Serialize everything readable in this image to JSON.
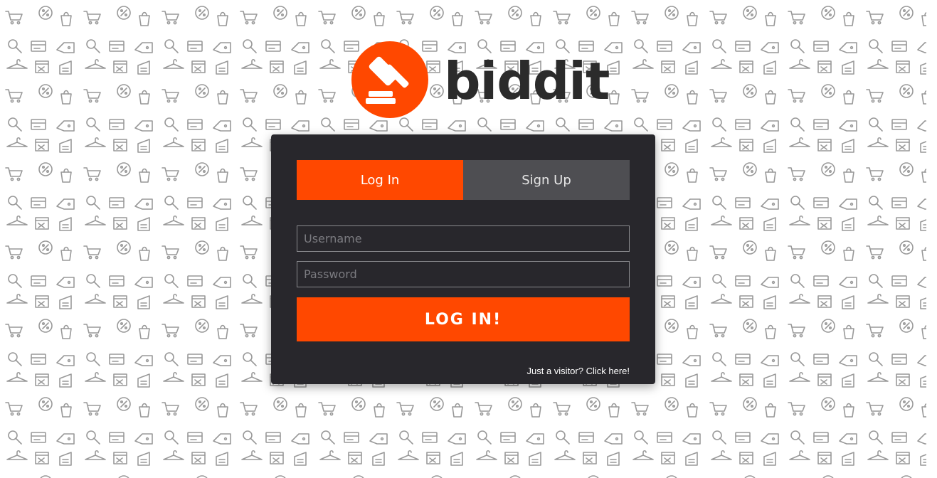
{
  "brand": {
    "name": "biddit",
    "accent_color": "#ff4800",
    "logo_icon": "gavel-icon"
  },
  "auth_tabs": {
    "login_label": "Log In",
    "signup_label": "Sign Up",
    "active": "login"
  },
  "form": {
    "username_placeholder": "Username",
    "username_value": "",
    "password_placeholder": "Password",
    "password_value": "",
    "submit_label": "LOG IN!"
  },
  "visitor_link": "Just a visitor? Click here!",
  "colors": {
    "card_bg": "#28272c",
    "inactive_tab": "#4e4e52"
  }
}
